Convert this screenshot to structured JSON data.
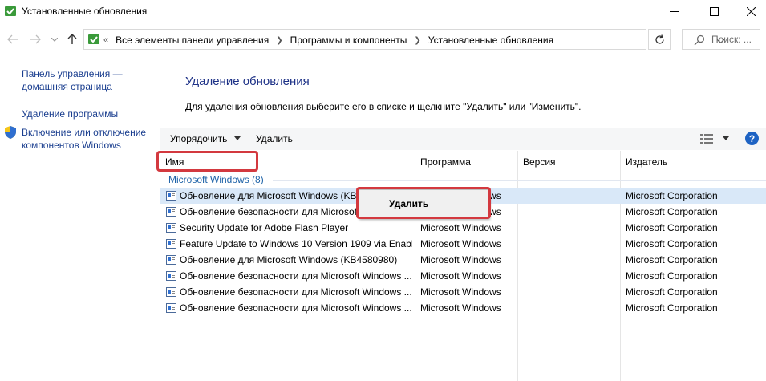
{
  "window": {
    "title": "Установленные обновления"
  },
  "address": {
    "overflow": "«",
    "crumbs": [
      "Все элементы панели управления",
      "Программы и компоненты",
      "Установленные обновления"
    ],
    "search_placeholder": "Поиск: ..."
  },
  "sidebar": {
    "items": [
      {
        "label_line1": "Панель управления —",
        "label_line2": "домашняя страница"
      },
      {
        "label_line1": "Удаление программы"
      },
      {
        "label_line1": "Включение или отключение",
        "label_line2": "компонентов Windows"
      }
    ]
  },
  "main": {
    "heading": "Удаление обновления",
    "instruction": "Для удаления обновления выберите его в списке и щелкните \"Удалить\" или \"Изменить\"."
  },
  "toolbar": {
    "sort_label": "Упорядочить",
    "delete_label": "Удалить",
    "help_label": "?"
  },
  "columns": [
    "Имя",
    "Программа",
    "Версия",
    "Издатель"
  ],
  "group": {
    "label": "Microsoft Windows (8)"
  },
  "rows": [
    {
      "name": "Обновление для Microsoft Windows (KB4",
      "program": "Microsoft Windows",
      "publisher": "Microsoft Corporation"
    },
    {
      "name": "Обновление безопасности для Microsoft",
      "program": "Microsoft Windows",
      "publisher": "Microsoft Corporation"
    },
    {
      "name": "Security Update for Adobe Flash Player",
      "program": "Microsoft Windows",
      "publisher": "Microsoft Corporation"
    },
    {
      "name": "Feature Update to Windows 10 Version 1909 via Enabl...",
      "program": "Microsoft Windows",
      "publisher": "Microsoft Corporation"
    },
    {
      "name": "Обновление для Microsoft Windows (KB4580980)",
      "program": "Microsoft Windows",
      "publisher": "Microsoft Corporation"
    },
    {
      "name": "Обновление безопасности для Microsoft Windows ...",
      "program": "Microsoft Windows",
      "publisher": "Microsoft Corporation"
    },
    {
      "name": "Обновление безопасности для Microsoft Windows ...",
      "program": "Microsoft Windows",
      "publisher": "Microsoft Corporation"
    },
    {
      "name": "Обновление безопасности для Microsoft Windows ...",
      "program": "Microsoft Windows",
      "publisher": "Microsoft Corporation"
    }
  ],
  "context_menu": {
    "items": [
      "Удалить"
    ]
  },
  "colors": {
    "link": "#1a3e8f",
    "heading": "#1e3287",
    "selection": "#d9e8f8",
    "highlight": "#d3393f",
    "help": "#1e63c3"
  }
}
